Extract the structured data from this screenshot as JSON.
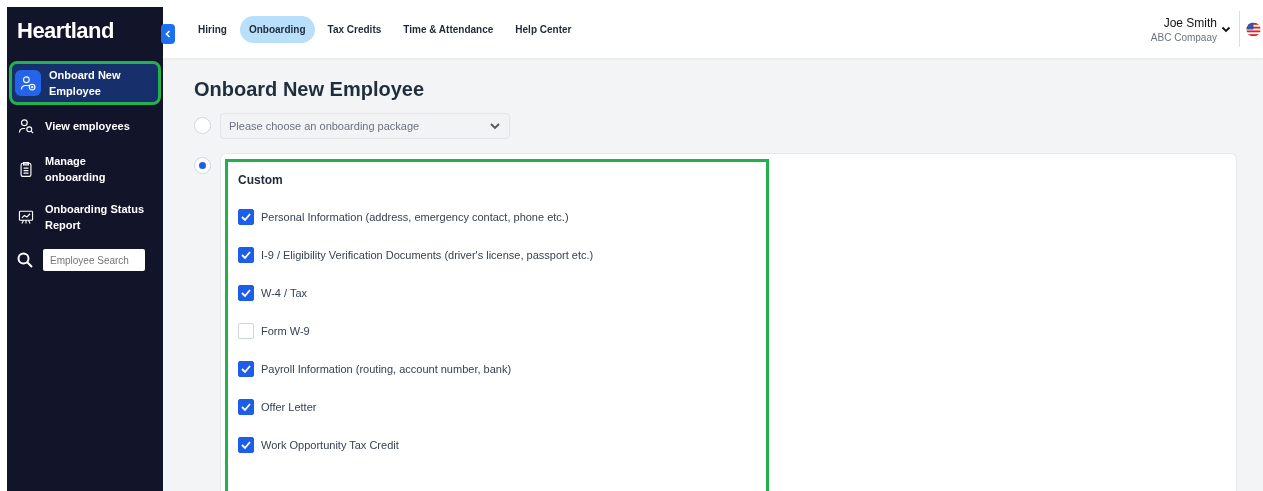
{
  "sidebar": {
    "logo": "Heartland",
    "items": [
      {
        "label": "Onboard New Employee",
        "selected": true,
        "highlighted": true
      },
      {
        "label": "View employees",
        "selected": false,
        "highlighted": false
      },
      {
        "label": "Manage onboarding",
        "selected": false,
        "highlighted": false
      },
      {
        "label": "Onboarding Status Report",
        "selected": false,
        "highlighted": false
      }
    ],
    "search": {
      "placeholder": "Employee Search"
    }
  },
  "tabs": [
    {
      "label": "Hiring",
      "selected": false
    },
    {
      "label": "Onboarding",
      "selected": true
    },
    {
      "label": "Tax Credits",
      "selected": false
    },
    {
      "label": "Time & Attendance",
      "selected": false
    },
    {
      "label": "Help Center",
      "selected": false
    }
  ],
  "user": {
    "name": "Joe Smith",
    "company": "ABC Compaay"
  },
  "page_title": "Onboard New Employee",
  "package_option": {
    "selected": false,
    "placeholder": "Please choose an onboarding package"
  },
  "custom_option": {
    "selected": true,
    "highlighted": true,
    "title": "Custom",
    "items": [
      {
        "label": "Personal Information (address, emergency contact, phone etc.)",
        "checked": true
      },
      {
        "label": "I-9 / Eligibility Verification Documents (driver's license, passport etc.)",
        "checked": true
      },
      {
        "label": "W-4 / Tax",
        "checked": true
      },
      {
        "label": "Form W-9",
        "checked": false
      },
      {
        "label": "Payroll Information (routing, account number, bank)",
        "checked": true
      },
      {
        "label": "Offer Letter",
        "checked": true
      },
      {
        "label": "Work Opportunity Tax Credit",
        "checked": true
      }
    ]
  }
}
